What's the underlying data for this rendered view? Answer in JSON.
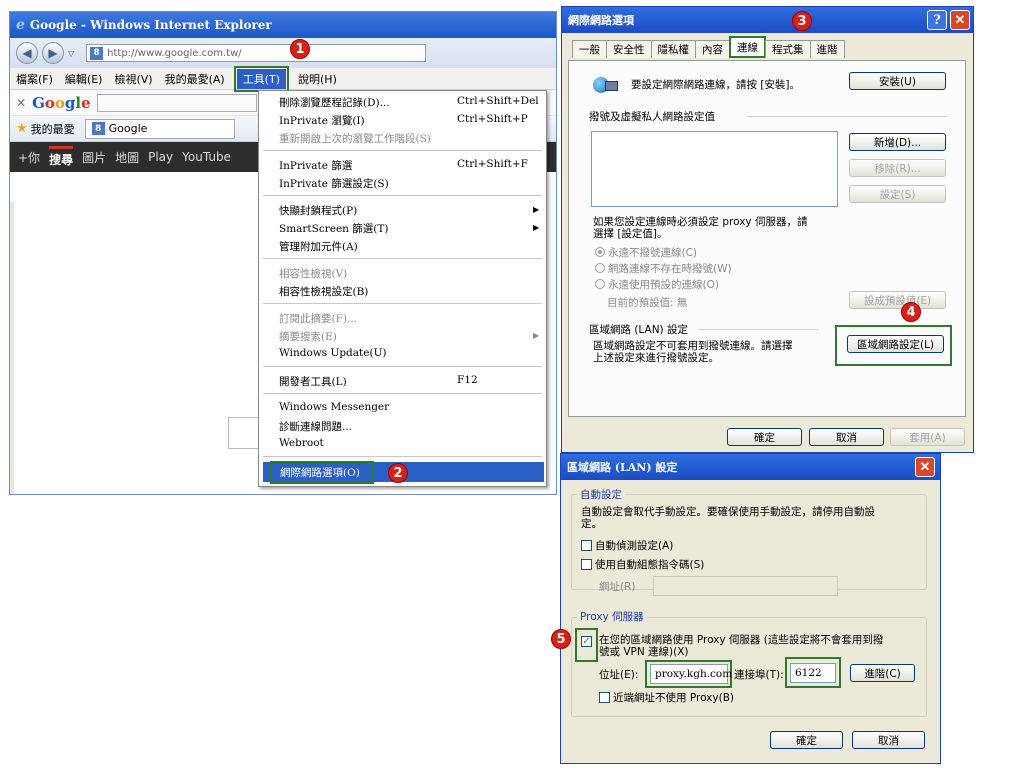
{
  "ie": {
    "title": "Google - Windows Internet Explorer",
    "address": "http://www.google.com.tw/",
    "menu": [
      "檔案(F)",
      "編輯(E)",
      "檢視(V)",
      "我的最愛(A)",
      "工具(T)",
      "說明(H)"
    ],
    "search_logo": [
      "G",
      "o",
      "o",
      "g",
      "l",
      "e"
    ],
    "favorites_label": "我的最愛",
    "tab_label": "Google",
    "google_bar": [
      "+你",
      "搜尋",
      "圖片",
      "地圖",
      "Play",
      "YouTube"
    ]
  },
  "tools_menu": {
    "groups": [
      [
        {
          "label": "刪除瀏覽歷程記錄(D)...",
          "shortcut": "Ctrl+Shift+Del",
          "disabled": false
        },
        {
          "label": "InPrivate 瀏覽(I)",
          "shortcut": "Ctrl+Shift+P",
          "disabled": false
        },
        {
          "label": "重新開啟上次的瀏覽工作階段(S)",
          "shortcut": "",
          "disabled": true
        }
      ],
      [
        {
          "label": "InPrivate 篩選",
          "shortcut": "Ctrl+Shift+F",
          "disabled": false
        },
        {
          "label": "InPrivate 篩選設定(S)",
          "shortcut": "",
          "disabled": false
        }
      ],
      [
        {
          "label": "快顯封鎖程式(P)",
          "shortcut": "",
          "disabled": false,
          "submenu": true
        },
        {
          "label": "SmartScreen 篩選(T)",
          "shortcut": "",
          "disabled": false,
          "submenu": true
        },
        {
          "label": "管理附加元件(A)",
          "shortcut": "",
          "disabled": false
        }
      ],
      [
        {
          "label": "相容性檢視(V)",
          "shortcut": "",
          "disabled": true
        },
        {
          "label": "相容性檢視設定(B)",
          "shortcut": "",
          "disabled": false
        }
      ],
      [
        {
          "label": "訂閱此摘要(F)...",
          "shortcut": "",
          "disabled": true
        },
        {
          "label": "摘要搜索(E)",
          "shortcut": "",
          "disabled": true,
          "submenu": true
        },
        {
          "label": "Windows Update(U)",
          "shortcut": "",
          "disabled": false
        }
      ],
      [
        {
          "label": "開發者工具(L)",
          "shortcut": "F12",
          "disabled": false
        }
      ],
      [
        {
          "label": "Windows Messenger",
          "shortcut": "",
          "disabled": false
        },
        {
          "label": "診斷連線問題...",
          "shortcut": "",
          "disabled": false
        },
        {
          "label": "Webroot",
          "shortcut": "",
          "disabled": false
        }
      ]
    ],
    "highlighted": "網際網路選項(O)"
  },
  "badges": [
    "1",
    "2",
    "3",
    "4",
    "5"
  ],
  "options_dialog": {
    "title": "網際網路選項",
    "help_button": "?",
    "close_button": "✕",
    "tabs": [
      "一般",
      "安全性",
      "隱私權",
      "內容",
      "連線",
      "程式集",
      "進階"
    ],
    "active_tab": "連線",
    "setup_text": "要設定網際網路連線，請按 [安裝]。",
    "setup_button": "安裝(U)",
    "dialup_group": "撥號及虛擬私人網路設定值",
    "add_button": "新增(D)...",
    "remove_button": "移除(R)...",
    "settings_button": "設定(S)",
    "proxy_note_1": "如果您設定連線時必須設定 proxy 伺服器，請",
    "proxy_note_2": "選擇 [設定值]。",
    "radios": [
      "永遠不撥號連線(C)",
      "網路連線不存在時撥號(W)",
      "永遠使用預設的連線(O)"
    ],
    "current_default": "目前的預設值:  無",
    "set_default_button": "設成預設值(E)",
    "lan_group": "區域網路 (LAN) 設定",
    "lan_note_1": "區域網路設定不可套用到撥號連線。請選擇",
    "lan_note_2": "上述設定來進行撥號設定。",
    "lan_button": "區域網路設定(L)",
    "ok": "確定",
    "cancel": "取消",
    "apply": "套用(A)"
  },
  "lan_dialog": {
    "title": "區域網路 (LAN) 設定",
    "close_button": "✕",
    "auto_group": "自動設定",
    "auto_note_1": "自動設定會取代手動設定。要確保使用手動設定，請停用自動設",
    "auto_note_2": "定。",
    "auto_detect": "自動偵測設定(A)",
    "auto_script": "使用自動組態指令碼(S)",
    "address_label_disabled": "網址(R)",
    "proxy_group": "Proxy 伺服器",
    "proxy_check_1": "在您的區域網路使用 Proxy 伺服器 (這些設定將不會套用到撥",
    "proxy_check_2": "號或 VPN 連線)(X)",
    "proxy_checked": "✓",
    "addr_label": "位址(E):",
    "addr_value": "proxy.kgh.com",
    "port_label": "連接埠(T):",
    "port_value": "6122",
    "advanced_button": "進階(C)",
    "bypass": "近端網址不使用 Proxy(B)",
    "ok": "確定",
    "cancel": "取消"
  }
}
